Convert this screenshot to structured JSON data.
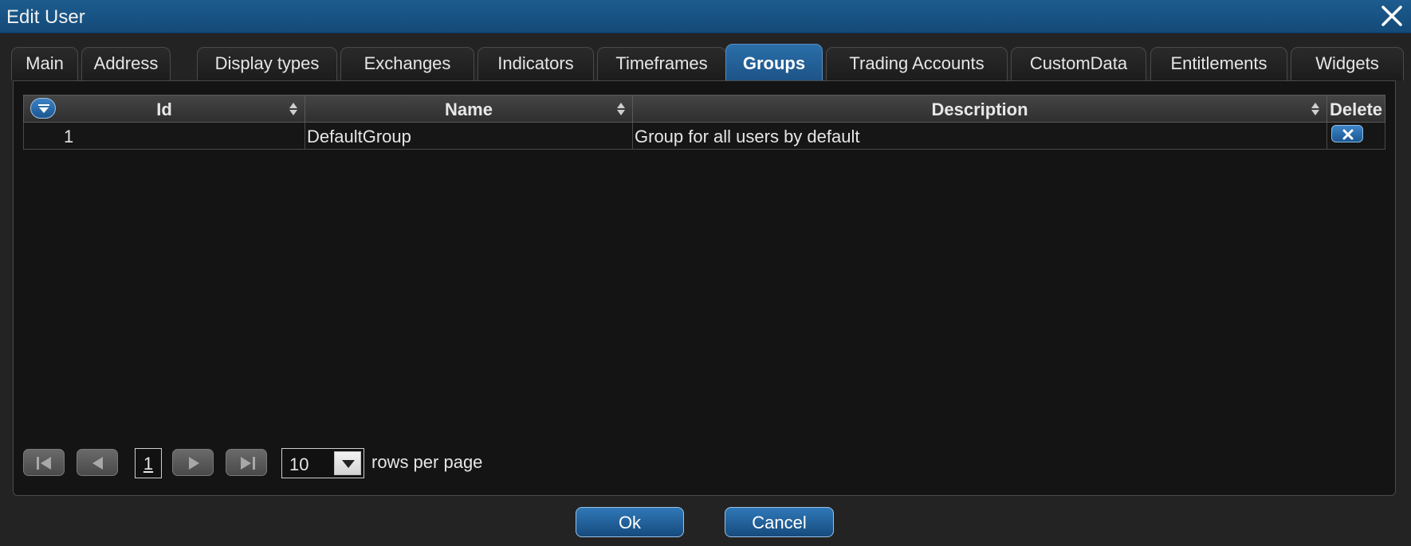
{
  "window": {
    "title": "Edit User",
    "close_icon": "close-icon"
  },
  "tabs": [
    {
      "label": "Main"
    },
    {
      "label": "Address"
    },
    {
      "label": "Display types"
    },
    {
      "label": "Exchanges"
    },
    {
      "label": "Indicators"
    },
    {
      "label": "Timeframes"
    },
    {
      "label": "Groups",
      "active": true
    },
    {
      "label": "Trading Accounts"
    },
    {
      "label": "CustomData"
    },
    {
      "label": "Entitlements"
    },
    {
      "label": "Widgets"
    }
  ],
  "grid": {
    "columns": [
      "Id",
      "Name",
      "Description",
      "Delete"
    ],
    "rows": [
      {
        "id": "1",
        "name": "DefaultGroup",
        "description": "Group for all users by default"
      }
    ]
  },
  "pager": {
    "current_page": "1",
    "rows_per_page_value": "10",
    "rows_per_page_label": "rows per page"
  },
  "buttons": {
    "ok": "Ok",
    "cancel": "Cancel"
  },
  "colors": {
    "titlebar": "#1d5c8f",
    "active_tab": "#2a6ea9",
    "panel_bg": "#141414"
  }
}
